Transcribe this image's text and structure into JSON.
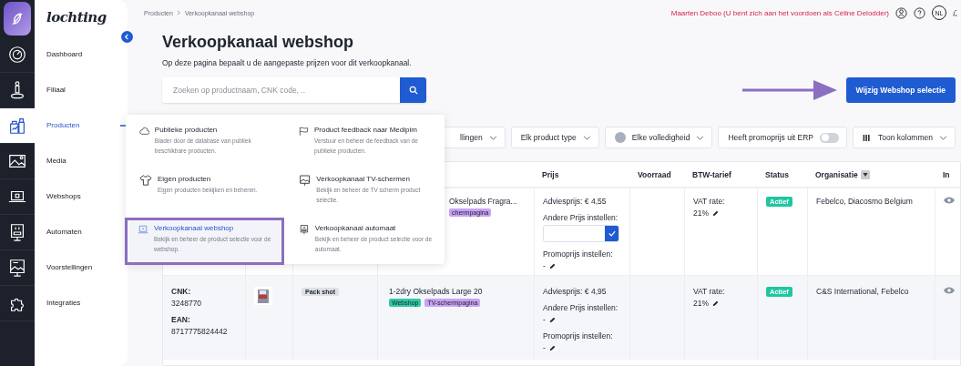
{
  "logo": "lochting",
  "nav": {
    "items": [
      {
        "label": "Dashboard",
        "selected": false
      },
      {
        "label": "Filiaal",
        "selected": false
      },
      {
        "label": "Producten",
        "selected": true
      },
      {
        "label": "Media",
        "selected": false
      },
      {
        "label": "Webshops",
        "selected": false
      },
      {
        "label": "Automaten",
        "selected": false
      },
      {
        "label": "Voorstellingen",
        "selected": false
      },
      {
        "label": "Integraties",
        "selected": false
      }
    ]
  },
  "breadcrumb": [
    "Producten",
    "Verkoopkanaal webshop"
  ],
  "impersonation": "Maarten Deboo (U bent zich aan het voordoen als Céline Delodder)",
  "language": "NL",
  "title": "Verkoopkanaal webshop",
  "subtitle": "Op deze pagina bepaalt u de aangepaste prijzen voor dit verkoopkanaal.",
  "search": {
    "placeholder": "Zoeken op productnaam, CNK code, .."
  },
  "primary_button": "Wijzig Webshop selectie",
  "filters": [
    {
      "kind": "dropdown",
      "label": "llingen"
    },
    {
      "kind": "dropdown",
      "label": "Elk product type"
    },
    {
      "kind": "status",
      "label": "Elke volledigheid"
    },
    {
      "kind": "toggle",
      "label": "Heeft promoprijs uit ERP",
      "on": false
    },
    {
      "kind": "columns",
      "label": "Toon kolommen"
    }
  ],
  "columns": [
    "",
    "",
    "",
    "",
    "Prijs",
    "Voorraad",
    "BTW-tarief",
    "Status",
    "Organisatie",
    "In"
  ],
  "rows": [
    {
      "cnk_label": "",
      "cnk": "",
      "ean_label": "",
      "ean": "",
      "image": false,
      "media": "",
      "name": "Okselpads Fragra...",
      "tags": [
        {
          "label": "chermpagina",
          "color": "#c8a2f5"
        }
      ],
      "advies": "Adviesprijs: € 4,55",
      "other_label": "Andere Prijs instellen:",
      "editing": true,
      "other": "",
      "promo_label": "Promoprijs instellen:",
      "promo": "-",
      "vat_label": "VAT rate:",
      "vat": "21%",
      "status": "Actief",
      "org": "Febelco, Diacosmo Belgium"
    },
    {
      "cnk_label": "CNK:",
      "cnk": "3248770",
      "ean_label": "EAN:",
      "ean": "8717775824442",
      "image": true,
      "media": "Pack shot",
      "name": "1-2dry Okselpads Large 20",
      "tags": [
        {
          "label": "Webshop",
          "color": "#2fc9a8"
        },
        {
          "label": "TV-schermpagina",
          "color": "#c8a2f5"
        }
      ],
      "advies": "Adviesprijs: € 4,95",
      "other_label": "Andere Prijs instellen:",
      "editing": false,
      "other": "-",
      "promo_label": "Promoprijs instellen:",
      "promo": "-",
      "vat_label": "VAT rate:",
      "vat": "21%",
      "status": "Actief",
      "org": "C&S International, Febelco"
    }
  ],
  "menu": {
    "items": [
      {
        "title": "Publieke producten",
        "text": "Blader door de database van publiek beschikbare producten.",
        "selected": false
      },
      {
        "title": "Product feedback naar Medipim",
        "text": "Verstuur en beheer de feedback van de publieke producten.",
        "selected": false
      },
      {
        "title": "Eigen producten",
        "text": "Eigen producten bekijken en beheren.",
        "selected": false
      },
      {
        "title": "Verkoopkanaal TV-schermen",
        "text": "Bekijk en beheer de TV scherm product selectie.",
        "selected": false
      },
      {
        "title": "Verkoopkanaal webshop",
        "text": "Bekijk en beheer de product selectie voor de webshop.",
        "selected": true
      },
      {
        "title": "Verkoopkanaal automaat",
        "text": "Bekijk en beheer de product selectie voor de automaat.",
        "selected": false
      }
    ]
  }
}
